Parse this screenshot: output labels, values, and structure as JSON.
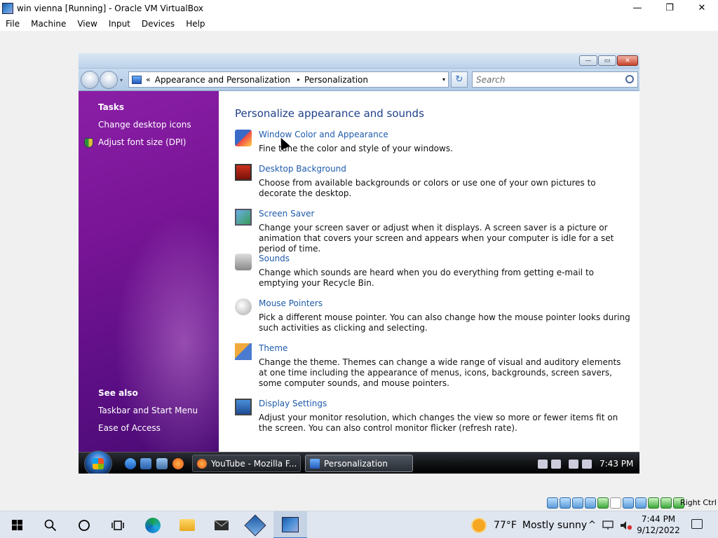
{
  "host": {
    "title": "win vienna [Running] - Oracle VM VirtualBox",
    "window_buttons": {
      "minimize": "—",
      "maximize": "❐",
      "close": "✕"
    },
    "menu": [
      "File",
      "Machine",
      "View",
      "Input",
      "Devices",
      "Help"
    ],
    "status_right": "Right Ctrl"
  },
  "guest": {
    "window_buttons": {
      "minimize": "—",
      "maximize": "▭",
      "close": "✕"
    },
    "address": {
      "chevron": "«",
      "crumbs": [
        "Appearance and Personalization",
        "Personalization"
      ],
      "separator": "▸",
      "dropdown": "▾"
    },
    "refresh_glyph": "↻",
    "search": {
      "placeholder": "Search"
    },
    "sidebar": {
      "tasks_heading": "Tasks",
      "tasks": [
        "Change desktop icons",
        "Adjust font size (DPI)"
      ],
      "see_also_heading": "See also",
      "see_also": [
        "Taskbar and Start Menu",
        "Ease of Access"
      ]
    },
    "main": {
      "heading": "Personalize appearance and sounds",
      "items": [
        {
          "title": "Window Color and Appearance",
          "desc": "Fine tune the color and style of your windows.",
          "icon": "window-color-icon"
        },
        {
          "title": "Desktop Background",
          "desc": "Choose from available backgrounds or colors or use one of your own pictures to decorate the desktop.",
          "icon": "desktop-background-icon"
        },
        {
          "title": "Screen Saver",
          "desc": "Change your screen saver or adjust when it displays. A screen saver is a picture or animation that covers your screen and appears when your computer is idle for a set period of time.",
          "icon": "screen-saver-icon"
        },
        {
          "title": "Sounds",
          "desc": "Change which sounds are heard when you do everything from getting e-mail to emptying your Recycle Bin.",
          "icon": "sounds-icon"
        },
        {
          "title": "Mouse Pointers",
          "desc": "Pick a different mouse pointer. You can also change how the mouse pointer looks during such activities as clicking and selecting.",
          "icon": "mouse-pointer-icon"
        },
        {
          "title": "Theme",
          "desc": "Change the theme. Themes can change a wide range of visual and auditory elements at one time including the appearance of menus, icons, backgrounds, screen savers, some computer sounds, and mouse pointers.",
          "icon": "theme-icon"
        },
        {
          "title": "Display Settings",
          "desc": "Adjust your monitor resolution, which changes the view so more or fewer items fit on the screen. You can also control monitor flicker (refresh rate).",
          "icon": "display-settings-icon"
        }
      ]
    },
    "taskbar": {
      "tasks": [
        {
          "label": "YouTube - Mozilla F...",
          "active": false
        },
        {
          "label": "Personalization",
          "active": true
        }
      ],
      "clock": "7:43 PM"
    }
  },
  "win10": {
    "weather": {
      "temp": "77°F",
      "desc": "Mostly sunny"
    },
    "tray_chevron": "^",
    "clock": {
      "time": "7:44 PM",
      "date": "9/12/2022"
    }
  },
  "colors": {
    "link": "#1e5bab",
    "heading": "#1e3f88",
    "sidebar_purple": "#7a1597"
  }
}
